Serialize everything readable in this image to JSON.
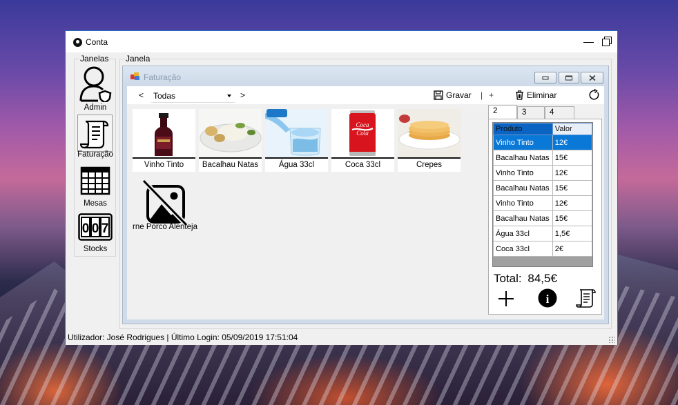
{
  "window": {
    "title": "Conta"
  },
  "left_panel": {
    "group_label": "Janelas",
    "items": [
      {
        "label": "Admin",
        "icon": "admin-user-shield-icon"
      },
      {
        "label": "Faturação",
        "icon": "receipt-scroll-icon",
        "selected": true
      },
      {
        "label": "Mesas",
        "icon": "table-grid-icon"
      },
      {
        "label": "Stocks",
        "icon": "counter-007-icon",
        "counter": [
          "0",
          "0",
          "7"
        ]
      }
    ]
  },
  "main_group": {
    "label": "Janela"
  },
  "child_window": {
    "title": "Faturação",
    "toolbar": {
      "prev": "<",
      "next": ">",
      "category": "Todas",
      "save_label": "Gravar",
      "separator": "|",
      "add_label": "+",
      "delete_label": "Eliminar"
    },
    "products": [
      {
        "name": "Vinho Tinto",
        "image": "wine-bottle"
      },
      {
        "name": "Bacalhau Natas",
        "image": "bacalhau-dish"
      },
      {
        "name": "Água 33cl",
        "image": "water-glass"
      },
      {
        "name": "Coca 33cl",
        "image": "coca-can"
      },
      {
        "name": "Crepes",
        "image": "crepes-plate"
      },
      {
        "name": "rne Porco Alentejа",
        "image": "no-image"
      }
    ],
    "tabs": [
      "2",
      "3",
      "4"
    ],
    "active_tab": "2",
    "order_table": {
      "columns": [
        "Produto",
        "Valor"
      ],
      "rows": [
        [
          "Vinho Tinto",
          "12€"
        ],
        [
          "Bacalhau Natas",
          "15€"
        ],
        [
          "Vinho Tinto",
          "12€"
        ],
        [
          "Bacalhau Natas",
          "15€"
        ],
        [
          "Vinho Tinto",
          "12€"
        ],
        [
          "Bacalhau Natas",
          "15€"
        ],
        [
          "Água 33cl",
          "1,5€"
        ],
        [
          "Coca 33cl",
          "2€"
        ]
      ],
      "selected_row": 0
    },
    "total": {
      "label": "Total:",
      "value": "84,5€"
    },
    "actions": {
      "add": "+",
      "info": "i"
    }
  },
  "status_bar": "Utilizador: José Rodrigues | Último Login: 05/09/2019 17:51:04"
}
